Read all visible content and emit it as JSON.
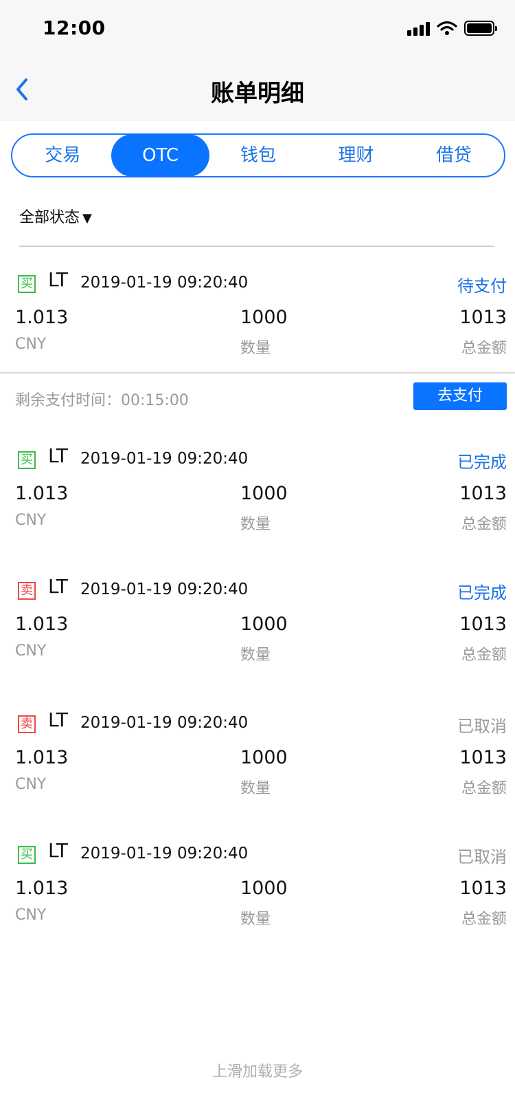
{
  "status_bar": {
    "time": "12:00"
  },
  "nav": {
    "title": "账单明细",
    "back_icon": "chevron-left-icon"
  },
  "tabs": [
    {
      "label": "交易",
      "active": false
    },
    {
      "label": "OTC",
      "active": true
    },
    {
      "label": "钱包",
      "active": false
    },
    {
      "label": "理财",
      "active": false
    },
    {
      "label": "借贷",
      "active": false
    }
  ],
  "filter": {
    "label": "全部状态",
    "arrow": "▼"
  },
  "orders": [
    {
      "side": "买",
      "side_type": "buy",
      "coin": "LT",
      "time": "2019-01-19 09:20:40",
      "status": "待支付",
      "price": "1.013",
      "price_unit": "CNY",
      "quantity": "1000",
      "quantity_label": "数量",
      "total": "1013",
      "total_label": "总金额"
    },
    {
      "side": "买",
      "side_type": "buy",
      "coin": "LT",
      "time": "2019-01-19 09:20:40",
      "status": "已完成",
      "price": "1.013",
      "price_unit": "CNY",
      "quantity": "1000",
      "quantity_label": "数量",
      "total": "1013",
      "total_label": "总金额"
    },
    {
      "side": "卖",
      "side_type": "sell",
      "coin": "LT",
      "time": "2019-01-19 09:20:40",
      "status": "已完成",
      "price": "1.013",
      "price_unit": "CNY",
      "quantity": "1000",
      "quantity_label": "数量",
      "total": "1013",
      "total_label": "总金额"
    },
    {
      "side": "卖",
      "side_type": "sell",
      "coin": "LT",
      "time": "2019-01-19 09:20:40",
      "status": "已取消",
      "price": "1.013",
      "price_unit": "CNY",
      "quantity": "1000",
      "quantity_label": "数量",
      "total": "1013",
      "total_label": "总金额"
    },
    {
      "side": "买",
      "side_type": "buy",
      "coin": "LT",
      "time": "2019-01-19 09:20:40",
      "status": "已取消",
      "price": "1.013",
      "price_unit": "CNY",
      "quantity": "1000",
      "quantity_label": "数量",
      "total": "1013",
      "total_label": "总金额"
    }
  ],
  "payment": {
    "remaining_label": "剩余支付时间：00:15:00",
    "pay_button": "去支付"
  },
  "load_more": "上滑加载更多",
  "colors": {
    "accent": "#0a73ff",
    "buy": "#3dbb4d",
    "sell": "#f04848",
    "muted": "#9a9a9a"
  }
}
